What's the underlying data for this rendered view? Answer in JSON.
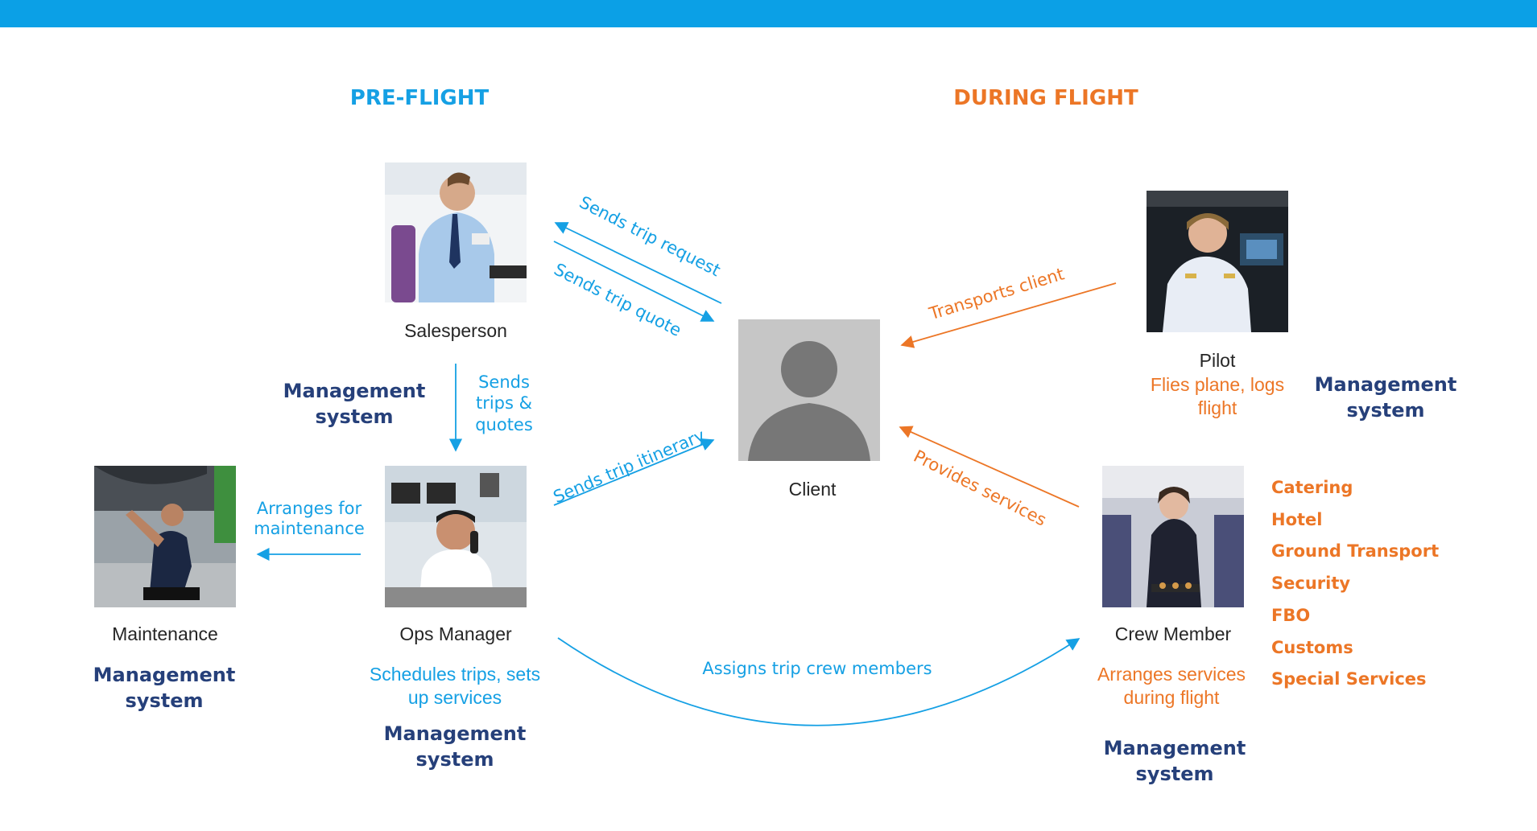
{
  "colors": {
    "topbar": "#0ba0e6",
    "preflight": "#15a0e4",
    "duringflight": "#ec7626",
    "management": "#26407a",
    "role_text": "#262626"
  },
  "sections": {
    "preflight": "PRE-FLIGHT",
    "duringflight": "DURING FLIGHT"
  },
  "nodes": {
    "salesperson": {
      "label": "Salesperson",
      "photo": "salesperson-photo"
    },
    "ops_manager": {
      "label": "Ops Manager",
      "desc_lines": [
        "Schedules trips, sets",
        "up services"
      ],
      "photo": "ops-manager-photo"
    },
    "maintenance": {
      "label": "Maintenance",
      "photo": "maintenance-photo"
    },
    "client": {
      "label": "Client",
      "photo": "client-avatar-icon"
    },
    "pilot": {
      "label": "Pilot",
      "desc_lines": [
        "Flies plane, logs",
        "flight"
      ],
      "photo": "pilot-photo"
    },
    "crew_member": {
      "label": "Crew Member",
      "desc_lines": [
        "Arranges services",
        "during flight"
      ],
      "photo": "crew-member-photo"
    }
  },
  "management_system": {
    "line1": "Management",
    "line2": "system"
  },
  "edges": {
    "sends_trip_request": "Sends trip request",
    "sends_trip_quote": "Sends trip quote",
    "sends_trips_quotes": [
      "Sends",
      "trips &",
      "quotes"
    ],
    "sends_trip_itinerary": "Sends trip itinerary",
    "arranges_for_maintenance": [
      "Arranges for",
      "maintenance"
    ],
    "transports_client": "Transports client",
    "provides_services": "Provides services",
    "assigns_trip_crew": "Assigns trip crew members"
  },
  "services": [
    "Catering",
    "Hotel",
    "Ground Transport",
    "Security",
    "FBO",
    "Customs",
    "Special Services"
  ]
}
